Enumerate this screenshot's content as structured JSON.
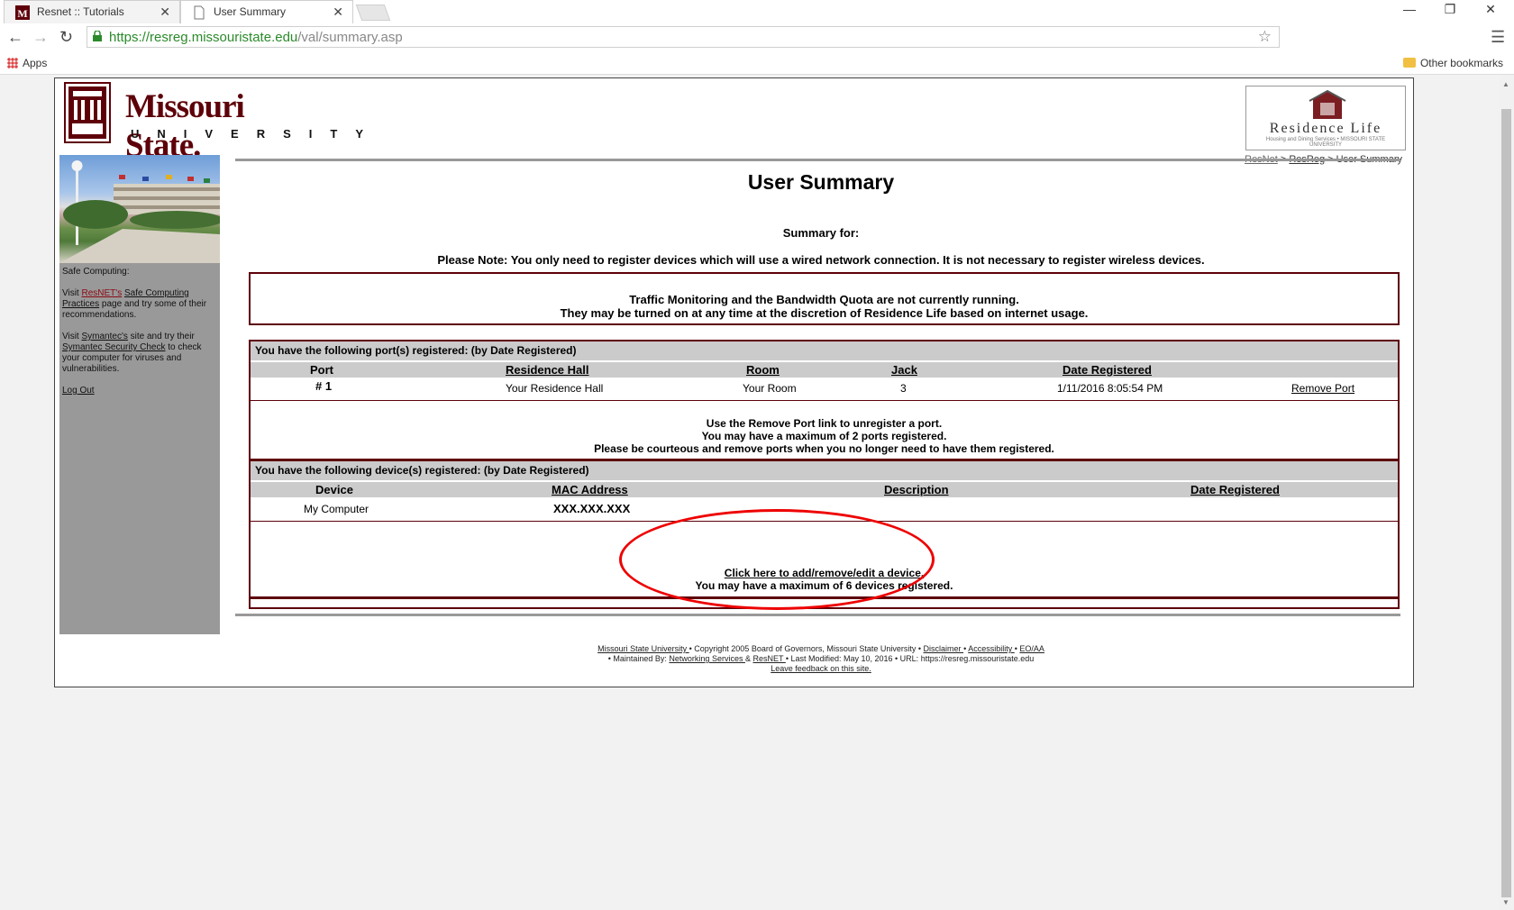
{
  "browser": {
    "tabs": [
      {
        "title": "Resnet :: Tutorials",
        "active": false
      },
      {
        "title": "User Summary",
        "active": true
      }
    ],
    "url_host": "https://resreg.missouristate.edu",
    "url_path": "/val/summary.asp",
    "bookmarks": {
      "apps": "Apps",
      "other": "Other bookmarks"
    },
    "icons": {
      "back": "←",
      "forward": "→",
      "reload": "↻",
      "star": "☆",
      "menu": "☰",
      "minimize": "—",
      "restore": "❐",
      "close": "✕",
      "tab_close": "✕"
    }
  },
  "header": {
    "logo_line1": "Missouri State.",
    "logo_line2": "UNIVERSITY",
    "reslife_title": "Residence Life",
    "reslife_sub": "Housing and Dining Services • MISSOURI STATE UNIVERSITY",
    "breadcrumb": {
      "item1": "ResNet",
      "sep": " > ",
      "item2": "ResReg",
      "current": "User Summary"
    }
  },
  "sidebar": {
    "heading": "Safe Computing:",
    "p1_pre": "Visit ",
    "p1_link1": "ResNET's",
    "p1_space": " ",
    "p1_link2": "Safe Computing Practices",
    "p1_post": " page and try some of their recommendations.",
    "p2_pre": "Visit ",
    "p2_link1": "Symantec's",
    "p2_mid": " site and try their ",
    "p2_link2": "Symantec Security Check",
    "p2_post": " to check your computer for viruses and vulnerabilities.",
    "logout": "Log Out"
  },
  "main": {
    "title": "User Summary",
    "summary_for": "Summary for:",
    "note": "Please Note: You only need to register devices which will use a wired network connection. It is not necessary to register wireless devices.",
    "traffic_line1": "Traffic Monitoring and the Bandwidth Quota are not currently running.",
    "traffic_line2": "They may be turned on at any time at the discretion of Residence Life based on internet usage.",
    "ports": {
      "header": "You have the following port(s) registered: (by Date Registered)",
      "columns": {
        "port": "Port",
        "hall": "Residence Hall",
        "room": "Room",
        "jack": "Jack",
        "date": "Date Registered"
      },
      "rows": [
        {
          "port": "# 1",
          "hall": "Your Residence Hall",
          "room": "Your Room",
          "jack": "3",
          "date": "1/11/2016 8:05:54 PM",
          "action": "Remove Port"
        }
      ],
      "msg1": "Use the Remove Port link to unregister a port.",
      "msg2": "You may have a maximum of 2 ports registered.",
      "msg3": "Please be courteous and remove ports when you no longer need to have them registered."
    },
    "devices": {
      "header": "You have the following device(s) registered: (by Date Registered)",
      "columns": {
        "device": "Device",
        "mac": "MAC Address",
        "desc": "Description",
        "date": "Date Registered"
      },
      "rows": [
        {
          "device": "My Computer",
          "mac": "XXX.XXX.XXX",
          "desc": "",
          "date": ""
        }
      ],
      "link": "Click here to add/remove/edit a device.",
      "msg": "You may have a maximum of 6 devices registered."
    }
  },
  "footer": {
    "line1": [
      {
        "text": "Missouri State University ",
        "link": true
      },
      {
        "text": " • Copyright 2005 Board of Governors, Missouri State University • ",
        "link": false
      },
      {
        "text": "Disclaimer ",
        "link": true
      },
      {
        "text": " • ",
        "link": false
      },
      {
        "text": "Accessibility ",
        "link": true
      },
      {
        "text": " • ",
        "link": false
      },
      {
        "text": "EO/AA",
        "link": true
      }
    ],
    "line2": [
      {
        "text": "• Maintained By: ",
        "link": false
      },
      {
        "text": "Networking Services ",
        "link": true
      },
      {
        "text": " & ",
        "link": false
      },
      {
        "text": "ResNET ",
        "link": true
      },
      {
        "text": " • Last Modified: May 10, 2016 • URL: https://resreg.missouristate.edu",
        "link": false
      }
    ],
    "line3": "Leave feedback on this site."
  }
}
